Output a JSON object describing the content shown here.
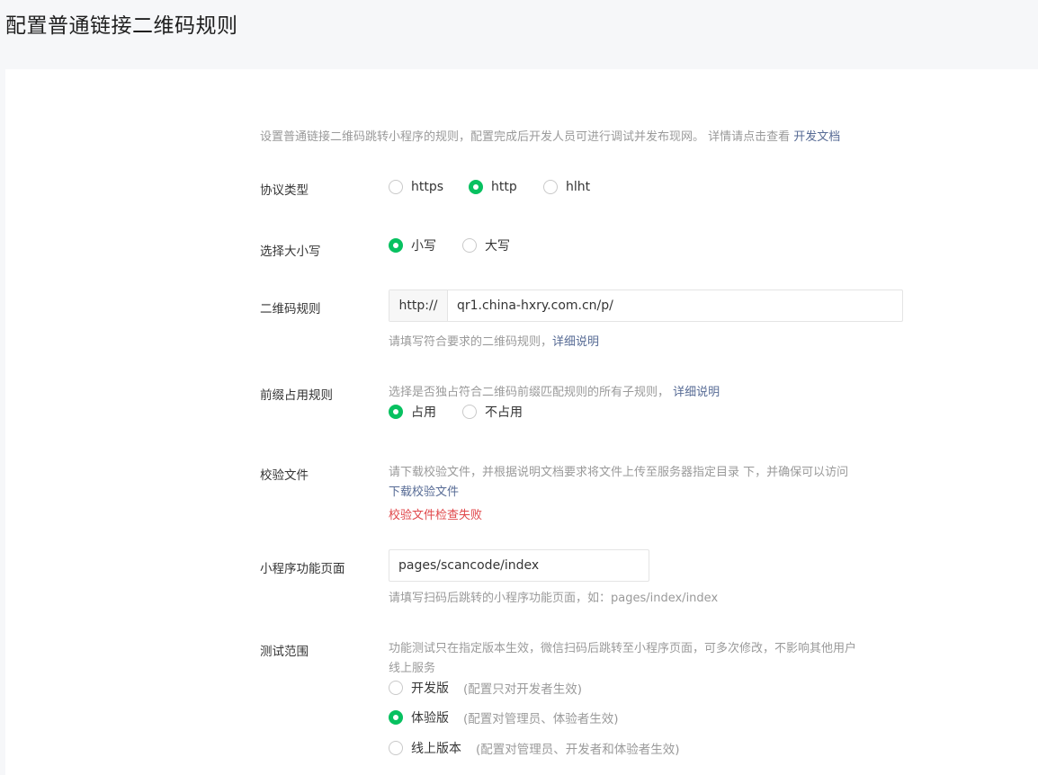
{
  "header": {
    "title": "配置普通链接二维码规则"
  },
  "intro": {
    "text": "设置普通链接二维码跳转小程序的规则，配置完成后开发人员可进行调试并发布现网。 详情请点击查看 ",
    "link": "开发文档"
  },
  "protocol": {
    "label": "协议类型",
    "options": [
      "https",
      "http",
      "hlht"
    ],
    "selected": "http"
  },
  "case": {
    "label": "选择大小写",
    "options": [
      "小写",
      "大写"
    ],
    "selected": "小写"
  },
  "qr_rule": {
    "label": "二维码规则",
    "prefix": "http://",
    "value": "qr1.china-hxry.com.cn/p/",
    "hint": "请填写符合要求的二维码规则，",
    "hint_link": "详细说明"
  },
  "prefix_rule": {
    "label": "前缀占用规则",
    "hint": "选择是否独占符合二维码前缀匹配规则的所有子规则，",
    "hint_link": "详细说明",
    "options": [
      "占用",
      "不占用"
    ],
    "selected": "占用"
  },
  "verify_file": {
    "label": "校验文件",
    "hint": "请下载校验文件，并根据说明文档要求将文件上传至服务器指定目录 下，并确保可以访问",
    "download_link": "下载校验文件",
    "error": "校验文件检查失败"
  },
  "page": {
    "label": "小程序功能页面",
    "value": "pages/scancode/index",
    "hint": "请填写扫码后跳转的小程序功能页面，如：pages/index/index"
  },
  "test_scope": {
    "label": "测试范围",
    "hint_line1": "功能测试只在指定版本生效，微信扫码后跳转至小程序页面，可多次修改，不影响其他用户",
    "hint_line2": "线上服务",
    "options": [
      {
        "label": "开发版",
        "note": "(配置只对开发者生效)"
      },
      {
        "label": "体验版",
        "note": "(配置对管理员、体验者生效)"
      },
      {
        "label": "线上版本",
        "note": "(配置对管理员、开发者和体验者生效)"
      }
    ],
    "selected": "体验版"
  },
  "colors": {
    "accent": "#07c160",
    "link": "#576b95",
    "error": "#e0474a",
    "hint": "#9a9a9a"
  },
  "icons": {
    "radio_checked": "radio-checked-icon",
    "radio_unchecked": "radio-unchecked-icon"
  }
}
